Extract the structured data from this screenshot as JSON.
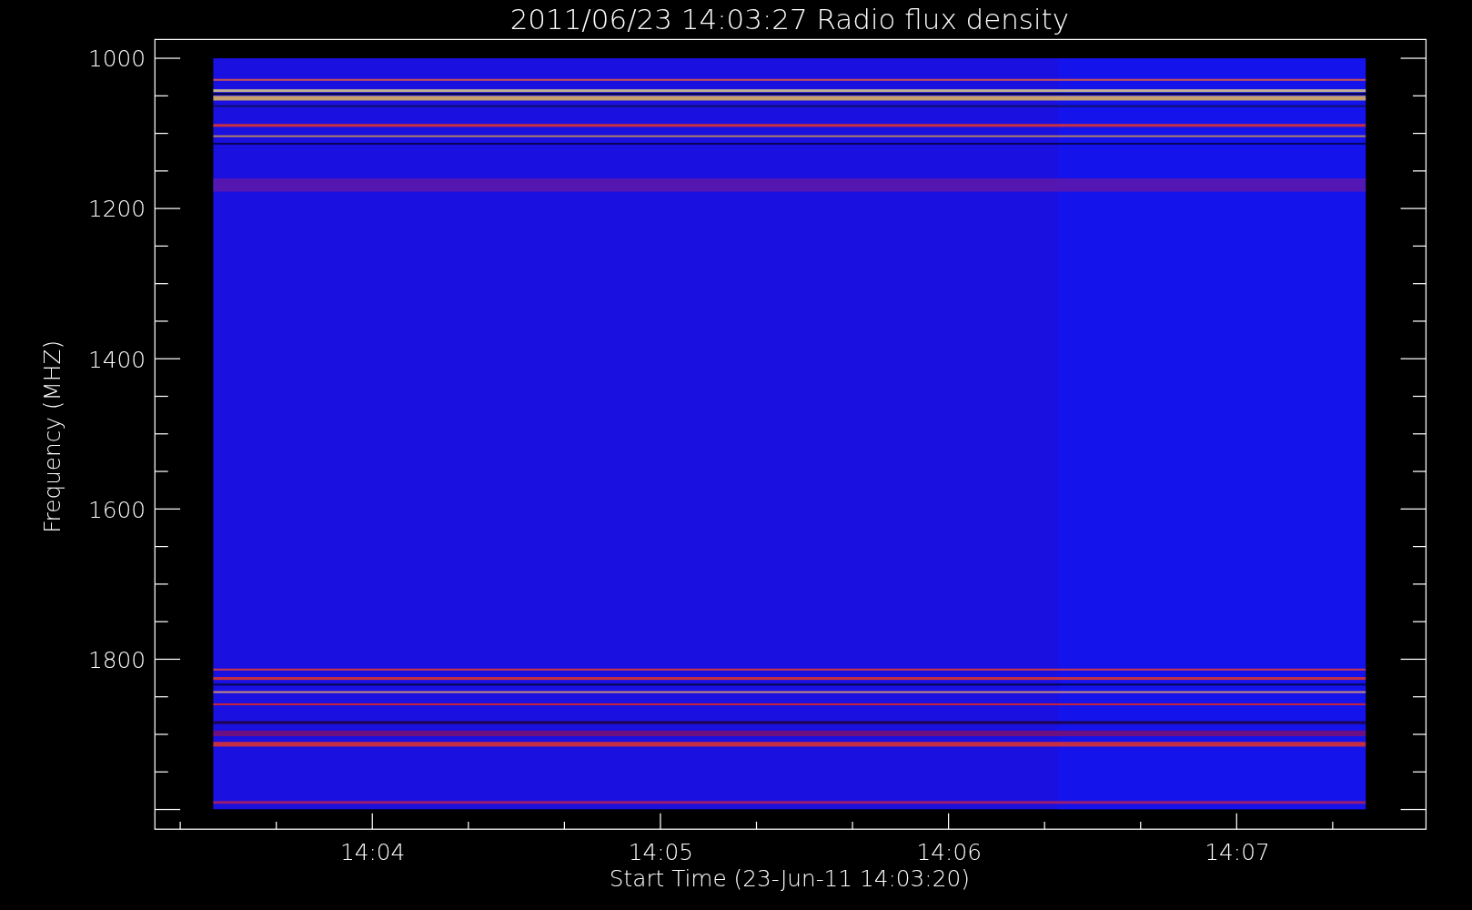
{
  "title": "2011/06/23 14:03:27 Radio flux density",
  "y_axis": {
    "label": "Frequency (MHZ)",
    "tick_labels": [
      "1000",
      "1200",
      "1400",
      "1600",
      "1800"
    ]
  },
  "x_axis": {
    "label": "Start Time (23-Jun-11 14:03:20)",
    "tick_labels": [
      "14:04",
      "14:05",
      "14:06",
      "14:07"
    ]
  }
}
